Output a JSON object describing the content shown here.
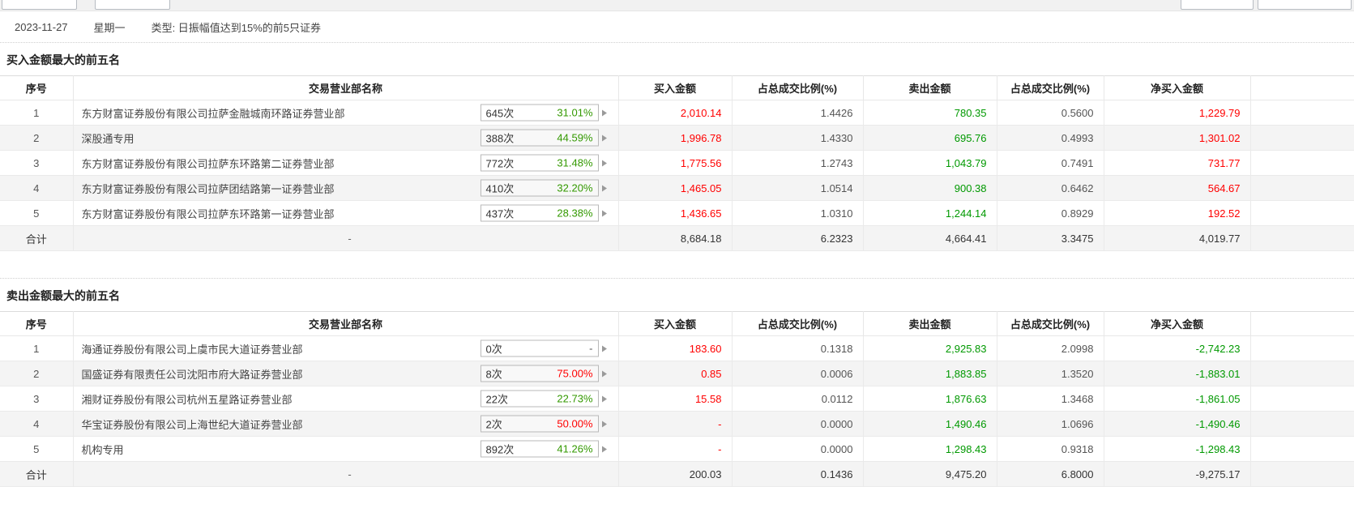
{
  "datebar": {
    "date": "2023-11-27",
    "weekday": "星期一",
    "type_text": "类型: 日振幅值达到15%的前5只证券"
  },
  "colors": {
    "up_red": "#ff0000",
    "down_green": "#009900",
    "button_pct_green": "#339900",
    "ratio_gray": "#555555"
  },
  "tables": [
    {
      "title": "买入金额最大的前五名",
      "columns": [
        "序号",
        "交易营业部名称",
        "买入金额",
        "占总成交比例(%)",
        "卖出金额",
        "占总成交比例(%)",
        "净买入金额"
      ],
      "rows": [
        {
          "no": "1",
          "name": "东方财富证券股份有限公司拉萨金融城南环路证券营业部",
          "times": "645次",
          "pct": "31.01%",
          "pct_color": "bgreen",
          "buy": "2,010.14",
          "buy_ratio": "1.4426",
          "sell": "780.35",
          "sell_ratio": "0.5600",
          "net": "1,229.79",
          "net_color": "red"
        },
        {
          "no": "2",
          "name": "深股通专用",
          "times": "388次",
          "pct": "44.59%",
          "pct_color": "bgreen",
          "buy": "1,996.78",
          "buy_ratio": "1.4330",
          "sell": "695.76",
          "sell_ratio": "0.4993",
          "net": "1,301.02",
          "net_color": "red"
        },
        {
          "no": "3",
          "name": "东方财富证券股份有限公司拉萨东环路第二证券营业部",
          "times": "772次",
          "pct": "31.48%",
          "pct_color": "bgreen",
          "buy": "1,775.56",
          "buy_ratio": "1.2743",
          "sell": "1,043.79",
          "sell_ratio": "0.7491",
          "net": "731.77",
          "net_color": "red"
        },
        {
          "no": "4",
          "name": "东方财富证券股份有限公司拉萨团结路第一证券营业部",
          "times": "410次",
          "pct": "32.20%",
          "pct_color": "bgreen",
          "buy": "1,465.05",
          "buy_ratio": "1.0514",
          "sell": "900.38",
          "sell_ratio": "0.6462",
          "net": "564.67",
          "net_color": "red"
        },
        {
          "no": "5",
          "name": "东方财富证券股份有限公司拉萨东环路第一证券营业部",
          "times": "437次",
          "pct": "28.38%",
          "pct_color": "bgreen",
          "buy": "1,436.65",
          "buy_ratio": "1.0310",
          "sell": "1,244.14",
          "sell_ratio": "0.8929",
          "net": "192.52",
          "net_color": "red"
        },
        {
          "no": "合计",
          "name": "-",
          "is_total": true,
          "buy": "8,684.18",
          "buy_ratio": "6.2323",
          "sell": "4,664.41",
          "sell_ratio": "3.3475",
          "net": "4,019.77",
          "net_color": "red"
        }
      ]
    },
    {
      "title": "卖出金额最大的前五名",
      "columns": [
        "序号",
        "交易营业部名称",
        "买入金额",
        "占总成交比例(%)",
        "卖出金额",
        "占总成交比例(%)",
        "净买入金额"
      ],
      "rows": [
        {
          "no": "1",
          "name": "海通证券股份有限公司上虞市民大道证券营业部",
          "times": "0次",
          "pct": "-",
          "pct_color": "gray",
          "buy": "183.60",
          "buy_ratio": "0.1318",
          "sell": "2,925.83",
          "sell_ratio": "2.0998",
          "net": "-2,742.23",
          "net_color": "green"
        },
        {
          "no": "2",
          "name": "国盛证券有限责任公司沈阳市府大路证券营业部",
          "times": "8次",
          "pct": "75.00%",
          "pct_color": "red",
          "buy": "0.85",
          "buy_ratio": "0.0006",
          "sell": "1,883.85",
          "sell_ratio": "1.3520",
          "net": "-1,883.01",
          "net_color": "green"
        },
        {
          "no": "3",
          "name": "湘财证券股份有限公司杭州五星路证券营业部",
          "times": "22次",
          "pct": "22.73%",
          "pct_color": "bgreen",
          "buy": "15.58",
          "buy_ratio": "0.0112",
          "sell": "1,876.63",
          "sell_ratio": "1.3468",
          "net": "-1,861.05",
          "net_color": "green"
        },
        {
          "no": "4",
          "name": "华宝证券股份有限公司上海世纪大道证券营业部",
          "times": "2次",
          "pct": "50.00%",
          "pct_color": "red",
          "buy": "-",
          "buy_ratio": "0.0000",
          "sell": "1,490.46",
          "sell_ratio": "1.0696",
          "net": "-1,490.46",
          "net_color": "green"
        },
        {
          "no": "5",
          "name": "机构专用",
          "times": "892次",
          "pct": "41.26%",
          "pct_color": "bgreen",
          "buy": "-",
          "buy_ratio": "0.0000",
          "sell": "1,298.43",
          "sell_ratio": "0.9318",
          "net": "-1,298.43",
          "net_color": "green"
        },
        {
          "no": "合计",
          "name": "-",
          "is_total": true,
          "buy": "200.03",
          "buy_ratio": "0.1436",
          "sell": "9,475.20",
          "sell_ratio": "6.8000",
          "net": "-9,275.17",
          "net_color": "green"
        }
      ]
    }
  ]
}
